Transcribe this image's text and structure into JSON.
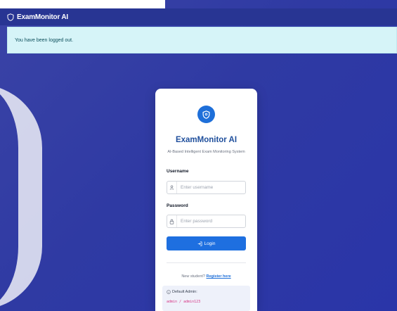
{
  "navbar": {
    "brand": "ExamMonitor AI"
  },
  "alert": {
    "message": "You have been logged out."
  },
  "login_card": {
    "title": "ExamMonitor AI",
    "subtitle": "AI-Based Intelligent Exam Monitoring System",
    "username_label": "Username",
    "username_placeholder": "Enter username",
    "username_value": "",
    "password_label": "Password",
    "password_placeholder": "Enter password",
    "password_value": "",
    "login_button": "Login",
    "register_prompt": "New student?",
    "register_link": "Register here",
    "default_admin_title": "Default Admin:",
    "default_admin_credentials": "admin / admin123"
  },
  "icons": {
    "brand": "shield-icon",
    "logo": "shield-icon",
    "username": "user-icon",
    "password": "lock-icon",
    "login": "sign-in-icon",
    "admin_info": "info-icon"
  },
  "colors": {
    "navbar": "#283593",
    "background": "#2f3aa3",
    "alert_bg": "#d6f4f8",
    "primary": "#1e6fe0",
    "title": "#1f4f9c",
    "credentials": "#d63384"
  }
}
